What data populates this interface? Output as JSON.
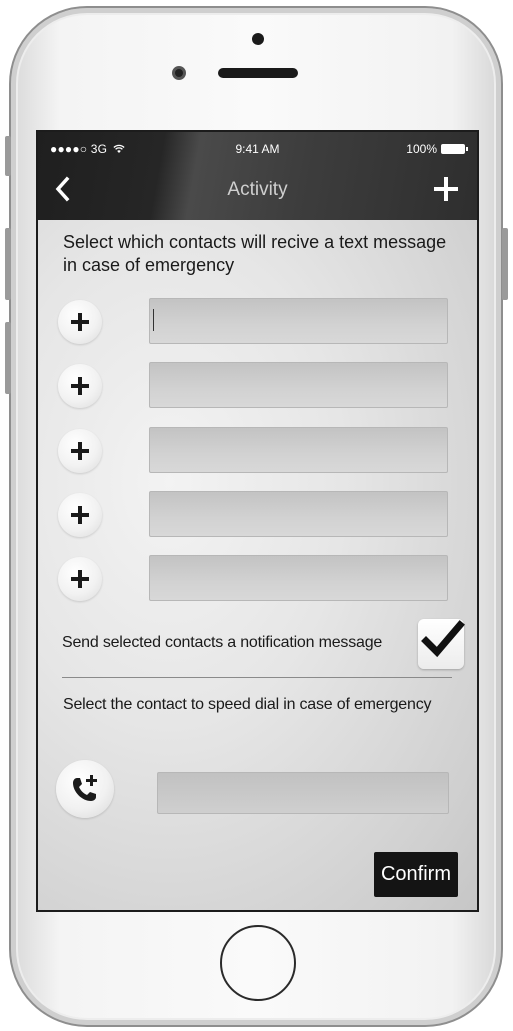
{
  "status_bar": {
    "carrier": "●●●●○ 3G",
    "time": "9:41 AM",
    "battery": "100%"
  },
  "nav": {
    "title": "Activity",
    "back_icon": "chevron-left-icon",
    "add_icon": "plus-icon"
  },
  "intro_text": "Select which contacts will recive a text message in case of emergency",
  "contacts": [
    {
      "value": "",
      "placeholder": ""
    },
    {
      "value": "",
      "placeholder": ""
    },
    {
      "value": "",
      "placeholder": ""
    },
    {
      "value": "",
      "placeholder": ""
    },
    {
      "value": "",
      "placeholder": ""
    }
  ],
  "notify": {
    "label": "Send selected contacts a notification message",
    "checked": true
  },
  "speed_dial": {
    "label": "Select the contact to speed dial in case of emergency",
    "value": "",
    "icon": "phone-add-icon"
  },
  "confirm_label": "Confirm",
  "colors": {
    "topbar": "#262626",
    "confirm_bg": "#141414",
    "field_bg": "#cccccc"
  }
}
